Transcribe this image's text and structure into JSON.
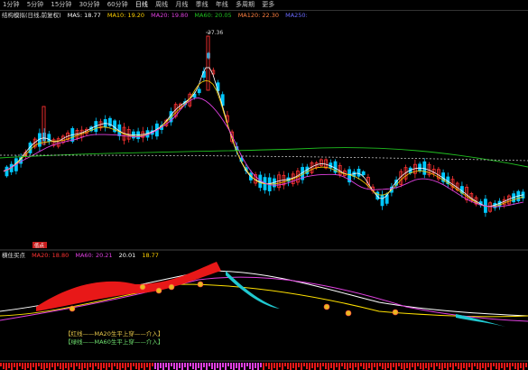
{
  "periods": [
    "1分钟",
    "5分钟",
    "15分钟",
    "30分钟",
    "60分钟",
    "日线",
    "周线",
    "月线",
    "季线",
    "年线",
    "多周期",
    "更多"
  ],
  "main_legend": {
    "title": "结构模拟(日线,前复权)",
    "ma5": "MA5: 18.77",
    "ma10": "MA10: 19.20",
    "ma20": "MA20: 19.80",
    "ma60": "MA60: 20.05",
    "ma120": "MA120: 22.30",
    "ma250": "MA250:"
  },
  "sub_legend": {
    "title": "横住买点",
    "ma20": "MA20: 18.80",
    "ma60": "MA60: 20.21",
    "v1": "20.01",
    "v2": "18.77"
  },
  "peak_label": "27.36",
  "low_label": "低点",
  "notes": [
    "【红线——MA20生平上穿——介入】",
    "【绿线——MA60生平上穿——介入】"
  ],
  "markers": [
    "介入",
    "介入",
    "介入",
    "介入",
    "介入",
    "介入",
    "介入"
  ],
  "colors": {
    "up": "#ff3232",
    "down": "#00c8ff",
    "ma5": "#ffffff",
    "ma10": "#ffd000",
    "ma20": "#e040e0",
    "ma60": "#20c020",
    "ma120": "#ff8040"
  }
}
